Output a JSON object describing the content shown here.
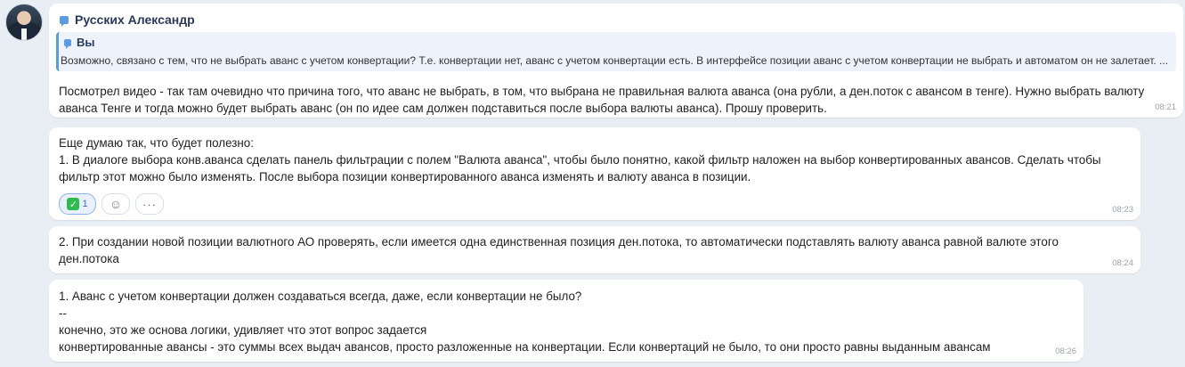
{
  "sender": {
    "name": "Русских Александр",
    "avatar_icon": "user-avatar"
  },
  "messages": [
    {
      "quote": {
        "author": "Вы",
        "text": "Возможно, связано с тем, что не выбрать аванс с учетом конвертации? Т.е. конвертации нет, аванс с учетом конвертации есть. В интерфейсе позиции аванс с учетом конвертации не выбрать и автоматом он не залетает. ..."
      },
      "text": "Посмотрел видео - так там очевидно что причина того, что аванс не выбрать, в том, что выбрана не правильная валюта аванса (она рубли, а ден.поток с авансом в тенге). Нужно выбрать валюту аванса Тенге и тогда можно будет выбрать аванс (он по идее сам должен подставиться после выбора валюты аванса). Прошу проверить.",
      "time": "08:21"
    },
    {
      "text": "Еще думаю так, что будет полезно:\n1. В диалоге выбора конв.аванса сделать панель фильтрации с полем \"Валюта аванса\", чтобы было понятно, какой фильтр наложен на выбор конвертированных авансов. Сделать чтобы фильтр этот можно было изменять. После выбора позиции конвертированного аванса изменять и валюту аванса в позиции.",
      "reaction": {
        "emoji": "✓",
        "count": "1"
      },
      "add_reaction_icon": "smiley-icon",
      "more_label": "···",
      "time": "08:23"
    },
    {
      "text": "2. При создании новой позиции валютного АО проверять, если имеется одна единственная позиция ден.потока, то автоматически подставлять валюту аванса равной валюте этого ден.потока",
      "time": "08:24"
    },
    {
      "text": "1. Аванс с учетом конвертации должен создаваться всегда, даже, если конвертации не было?\n--\nконечно, это же основа логики, удивляет что этот вопрос задается\nконвертированные авансы - это суммы всех выдач авансов, просто разложенные на конвертации. Если конвертаций не было, то они просто равны выданным авансам",
      "time": "08:26"
    }
  ],
  "colors": {
    "accent": "#5b9be0",
    "background": "#e9eef4",
    "reaction_green": "#2ebc4e"
  }
}
